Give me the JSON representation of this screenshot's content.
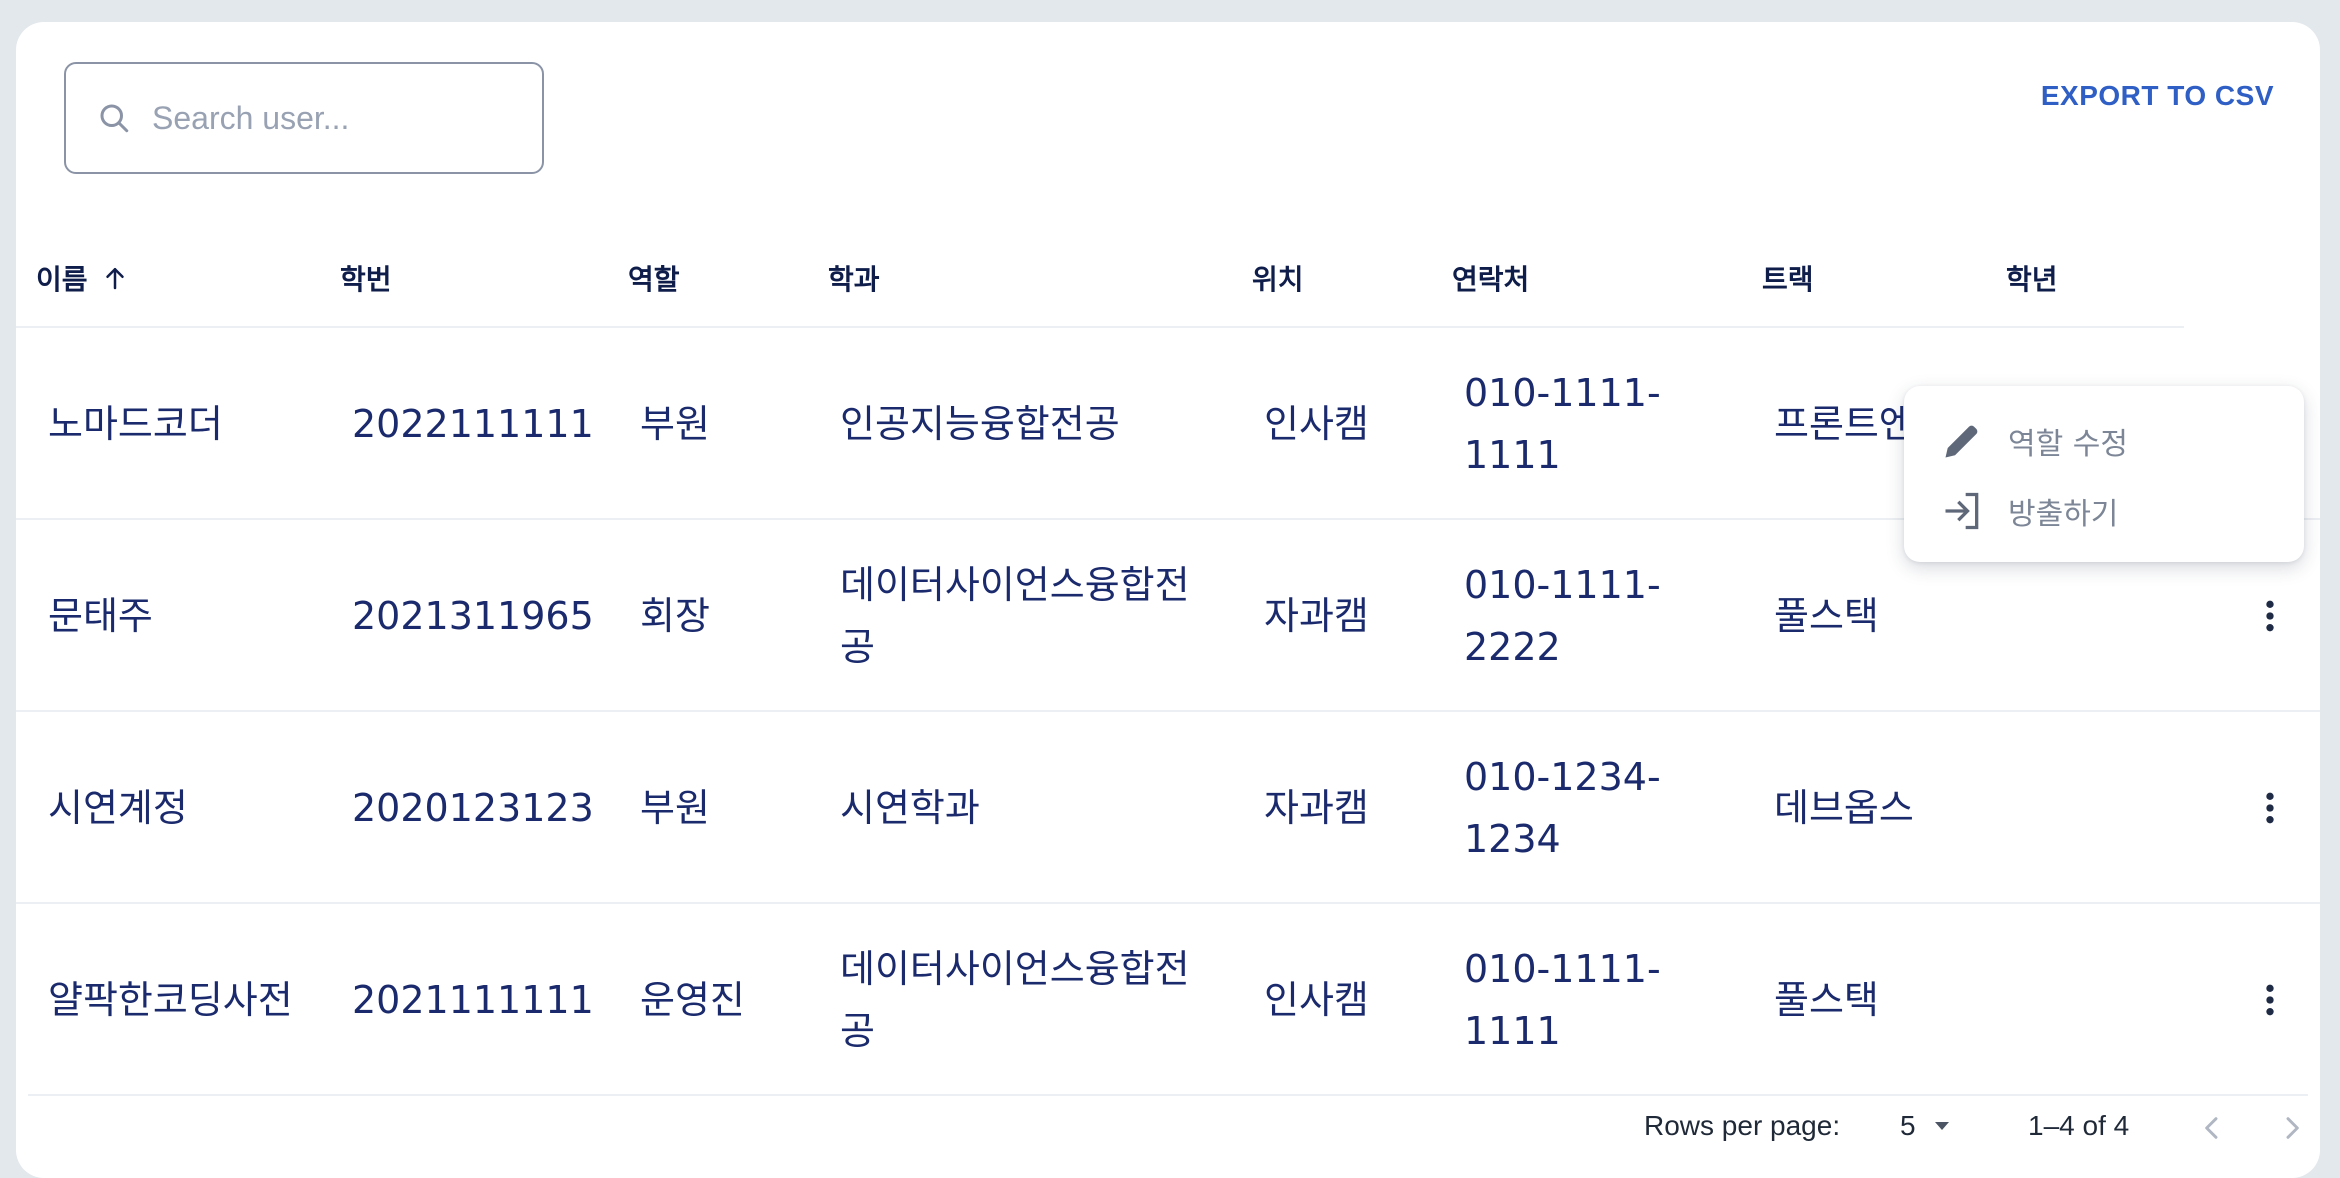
{
  "search": {
    "placeholder": "Search user..."
  },
  "toolbar": {
    "export_label": "EXPORT TO CSV"
  },
  "table": {
    "headers": [
      "이름",
      "학번",
      "역할",
      "학과",
      "위치",
      "연락처",
      "트랙",
      "학년"
    ],
    "sort": {
      "column": "이름",
      "direction": "ascending"
    },
    "rows": [
      {
        "name": "노마드코더",
        "id": "2022111111",
        "role": "부원",
        "dept": "인공지능융합전공",
        "location": "인사캠",
        "phone": "010-1111-1111",
        "track": "프론트엔드"
      },
      {
        "name": "문태주",
        "id": "2021311965",
        "role": "회장",
        "dept": "데이터사이언스융합전공",
        "location": "자과캠",
        "phone": "010-1111-2222",
        "track": "풀스택"
      },
      {
        "name": "시연계정",
        "id": "2020123123",
        "role": "부원",
        "dept": "시연학과",
        "location": "자과캠",
        "phone": "010-1234-1234",
        "track": "데브옵스"
      },
      {
        "name": "얄팍한코딩사전",
        "id": "2021111111",
        "role": "운영진",
        "dept": "데이터사이언스융합전공",
        "location": "인사캠",
        "phone": "010-1111-1111",
        "track": "풀스택"
      }
    ]
  },
  "menu": {
    "items": [
      {
        "label": "역할 수정",
        "icon": "pencil-icon"
      },
      {
        "label": "방출하기",
        "icon": "logout-icon"
      }
    ]
  },
  "pagination": {
    "rows_per_page_label": "Rows per page:",
    "rows_per_page_value": "5",
    "range_label": "1–4 of 4"
  },
  "colors": {
    "text": "#1a2a6c",
    "accent": "#2f5fc4",
    "muted": "#7c8696",
    "background": "#e3e8ec"
  }
}
